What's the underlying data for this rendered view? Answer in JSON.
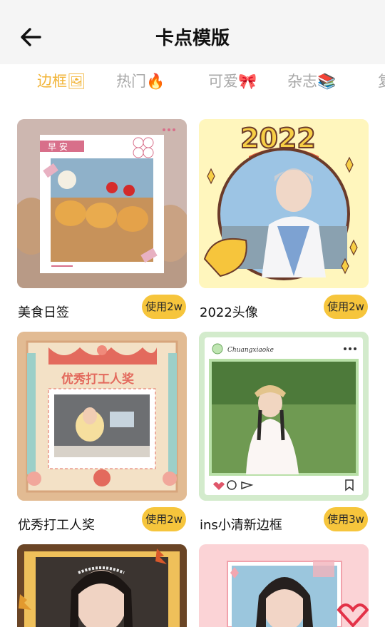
{
  "header": {
    "title": "卡点模版",
    "back_icon": "arrow-left-icon"
  },
  "tabs": [
    {
      "label": "边框🖼",
      "active": true
    },
    {
      "label": "热门🔥",
      "active": false
    },
    {
      "label": "可爱🎀",
      "active": false
    },
    {
      "label": "杂志📚",
      "active": false
    },
    {
      "label": "复",
      "active": false
    }
  ],
  "templates": [
    {
      "name": "美食日签",
      "usage": "使用2w",
      "tag": "早 安"
    },
    {
      "name": "2022头像",
      "usage": "使用2w",
      "year": "2022"
    },
    {
      "name": "优秀打工人奖",
      "usage": "使用2w",
      "banner": "优秀打工人奖"
    },
    {
      "name": "ins小清新边框",
      "usage": "使用3w",
      "handle": "Chuangxiaoke"
    },
    {
      "name": "",
      "usage": ""
    },
    {
      "name": "",
      "usage": ""
    }
  ],
  "colors": {
    "accent": "#f2b53a",
    "badge": "#f6c53c",
    "header_bg": "#f5f5f5"
  }
}
